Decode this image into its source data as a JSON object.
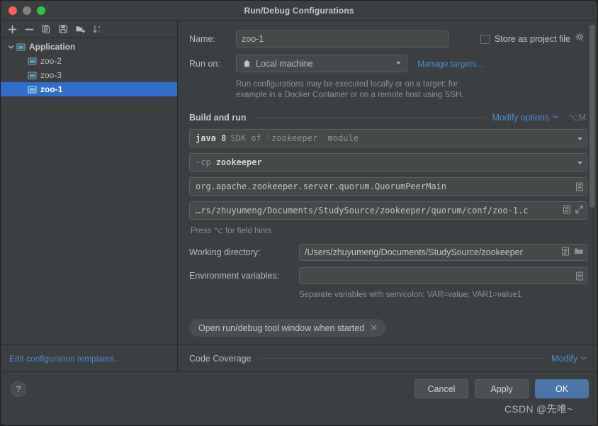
{
  "window": {
    "title": "Run/Debug Configurations",
    "traffic": {
      "close": "close-button",
      "minimize": "minimize-button",
      "zoom": "zoom-button"
    }
  },
  "sidebar": {
    "toolbar": [
      {
        "name": "add-configuration-button",
        "icon": "plus-icon"
      },
      {
        "name": "remove-configuration-button",
        "icon": "minus-icon"
      },
      {
        "name": "copy-configuration-button",
        "icon": "copy-icon"
      },
      {
        "name": "save-configuration-button",
        "icon": "save-icon"
      },
      {
        "name": "new-folder-button",
        "icon": "new-folder-icon"
      },
      {
        "name": "sort-configurations-button",
        "icon": "sort-alpha-icon"
      }
    ],
    "tree": {
      "group": {
        "label": "Application",
        "expanded": true
      },
      "items": [
        {
          "label": "zoo-2",
          "selected": false
        },
        {
          "label": "zoo-3",
          "selected": false
        },
        {
          "label": "zoo-1",
          "selected": true
        }
      ]
    },
    "edit_templates_link": "Edit configuration templates..."
  },
  "form": {
    "name_label": "Name:",
    "name_value": "zoo-1",
    "store_as_project_file_label": "Store as project file",
    "store_as_project_file_checked": false,
    "run_on_label": "Run on:",
    "run_on_value": "Local machine",
    "manage_targets_link": "Manage targets...",
    "run_on_hint_line1": "Run configurations may be executed locally or on a target: for",
    "run_on_hint_line2": "example in a Docker Container or on a remote host using SSH.",
    "build_and_run": {
      "section_title": "Build and run",
      "modify_options_label": "Modify options",
      "modify_options_shortcut": "⌥M",
      "sdk_prefix": "java 8",
      "sdk_suffix": "SDK of 'zookeeper' module",
      "classpath_prefix": "-cp",
      "classpath_value": "zookeeper",
      "main_class": "org.apache.zookeeper.server.quorum.QuorumPeerMain",
      "program_arguments": "…rs/zhuyumeng/Documents/StudySource/zookeeper/quorum/conf/zoo-1.c",
      "field_hints": "Press ⌥ for field hints"
    },
    "working_directory_label": "Working directory:",
    "working_directory_value": "/Users/zhuyumeng/Documents/StudySource/zookeeper",
    "environment_variables_label": "Environment variables:",
    "environment_variables_value": "",
    "environment_variables_placeholder": "",
    "env_hint": "Separate variables with semicolon: VAR=value; VAR1=value1",
    "chip_label": "Open run/debug tool window when started"
  },
  "code_coverage": {
    "section_title": "Code Coverage",
    "modify_label": "Modify"
  },
  "bottom": {
    "help_label": "?",
    "cancel_label": "Cancel",
    "apply_label": "Apply",
    "ok_label": "OK"
  },
  "watermark": {
    "text": "CSDN @先唯~"
  },
  "colors": {
    "accent_link": "#4a8bd4",
    "selection": "#2f6ec9",
    "primary_button": "#4a76a8",
    "panel_bg": "#3c3f41",
    "field_bg": "#45494a",
    "close_dot": "#ff5f57",
    "min_dot": "#808080",
    "zoom_dot": "#28c840"
  }
}
